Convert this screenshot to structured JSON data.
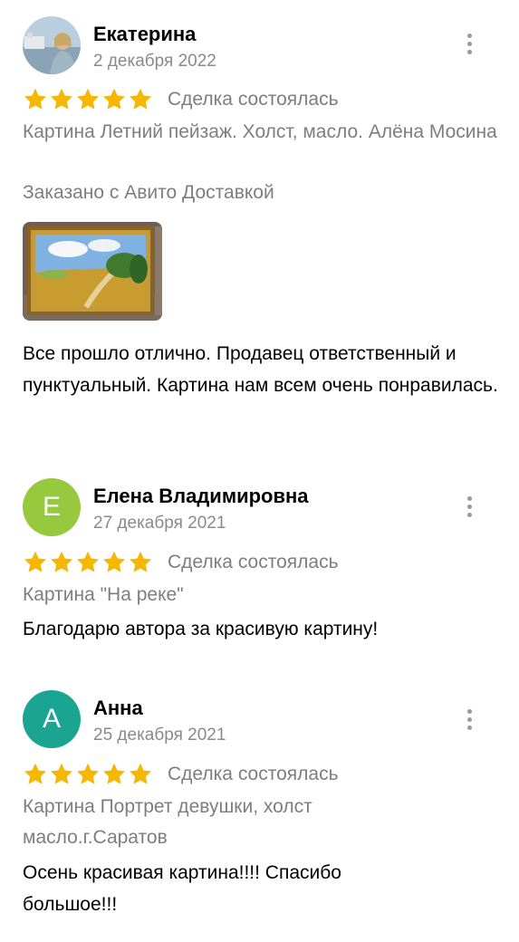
{
  "colors": {
    "star": "#f5b700",
    "avatar_elena": "#96c93d",
    "avatar_anna": "#1aa592",
    "secondary_text": "#8a8a8a",
    "more_dots": "#9a9a9a"
  },
  "reviews": [
    {
      "author": "Екатерина",
      "avatar": "photo",
      "date": "2 декабря 2022",
      "rating": 5,
      "deal_status": "Сделка состоялась",
      "item": "Картина Летний пейзаж. Холст, масло. Алёна Мосина",
      "delivery": "Заказано с Авито Доставкой",
      "photo": "framed-landscape-painting",
      "text": "Все прошло отлично. Продавец ответственный и пунктуальный. Картина нам всем очень понравилась."
    },
    {
      "author": "Елена Владимировна",
      "avatar_letter": "Е",
      "date": "27 декабря 2021",
      "rating": 5,
      "deal_status": "Сделка состоялась",
      "item": "Картина \"На реке\"",
      "text": "Благодарю автора за красивую картину!"
    },
    {
      "author": "Анна",
      "avatar_letter": "А",
      "date": "25 декабря 2021",
      "rating": 5,
      "deal_status": "Сделка состоялась",
      "item": "Картина Портрет девушки, холст масло.г.Саратов",
      "text": "Осень красивая картина!!!! Спасибо большое!!!"
    }
  ],
  "icons": {
    "star": "star-icon",
    "more": "more-vertical-icon"
  }
}
